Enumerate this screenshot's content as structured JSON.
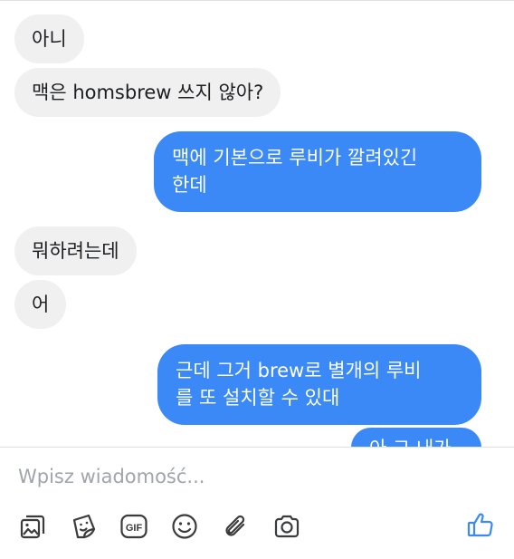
{
  "messages": [
    {
      "side": "in",
      "lines": [
        "아니"
      ]
    },
    {
      "side": "in",
      "lines": [
        "맥은 homsbrew 쓰지 않아?"
      ]
    },
    {
      "side": "out",
      "lines": [
        "맥에 기본으로 루비가 깔려있긴",
        "한데"
      ]
    },
    {
      "side": "in",
      "lines": [
        "뭐하려는데"
      ]
    },
    {
      "side": "in",
      "lines": [
        "어"
      ]
    },
    {
      "side": "out",
      "lines": [
        "근데 그거 brew로 별개의 루비",
        "를 또 설치할 수 있대"
      ]
    },
    {
      "side": "out",
      "lines": [
        "아 그 내가"
      ]
    }
  ],
  "composer": {
    "placeholder": "Wpisz wiadomość..."
  },
  "toolbar": {
    "icons": [
      "photo-icon",
      "sticker-icon",
      "gif-icon",
      "emoji-icon",
      "attachment-icon",
      "camera-icon",
      "like-icon"
    ],
    "gif_label": "GIF"
  },
  "colors": {
    "incoming_bubble": "#f1f0f0",
    "outgoing_bubble": "#3a89f6",
    "icon": "#3a3b3c",
    "like": "#3a89f6"
  }
}
